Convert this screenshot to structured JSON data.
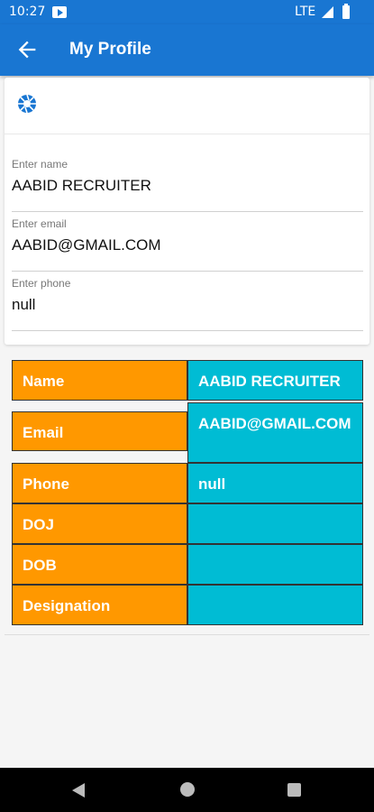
{
  "status_bar": {
    "time": "10:27",
    "network": "LTE"
  },
  "app_bar": {
    "title": "My Profile",
    "back_icon": "arrow-back-icon"
  },
  "camera": {
    "icon": "camera-aperture-icon"
  },
  "form": {
    "name": {
      "label": "Enter name",
      "value": "AABID RECRUITER"
    },
    "email": {
      "label": "Enter email",
      "value": "AABID@GMAIL.COM"
    },
    "phone": {
      "label": "Enter phone",
      "value": "null"
    }
  },
  "details_table": [
    {
      "key": "Name",
      "value": "AABID RECRUITER"
    },
    {
      "key": "Email",
      "value": "AABID@GMAIL.COM"
    },
    {
      "key": "Phone",
      "value": "null"
    },
    {
      "key": "DOJ",
      "value": ""
    },
    {
      "key": "DOB",
      "value": ""
    },
    {
      "key": "Designation",
      "value": ""
    }
  ],
  "colors": {
    "primary": "#1976d2",
    "key_cell": "#ff9800",
    "value_cell": "#00bcd4"
  }
}
